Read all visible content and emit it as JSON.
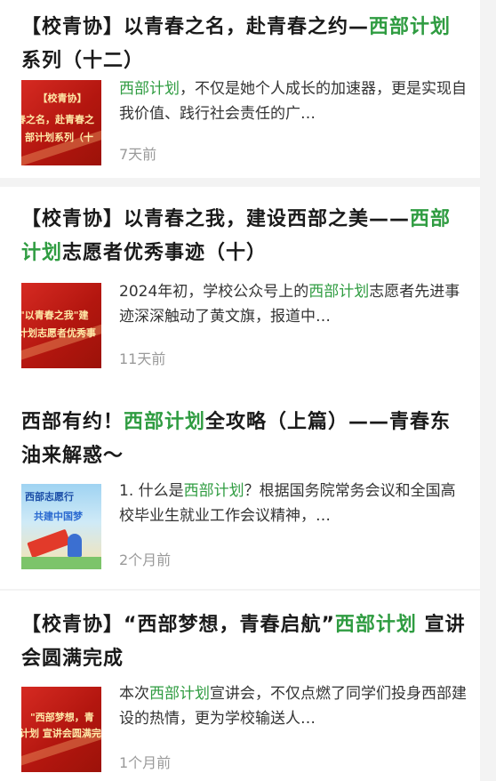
{
  "articles": [
    {
      "title_parts": {
        "before": "【校青协】以青春之名，赴青春之约—",
        "highlight": "西部计划",
        "after": "系列（十二）"
      },
      "summary_parts": {
        "before": "",
        "highlight": "西部计划",
        "after": "，不仅是她个人成长的加速器，更是实现自我价值、践行社会责任的广…"
      },
      "time": "7天前",
      "thumb_lines": [
        "【校青协】",
        "春之名，赴青春之",
        "部计划系列（十"
      ]
    },
    {
      "title_parts": {
        "before": "【校青协】以青春之我，建设西部之美——",
        "highlight": "西部计划",
        "after": "志愿者优秀事迹（十）"
      },
      "summary_parts": {
        "before": "2024年初，学校公众号上的",
        "highlight": "西部计划",
        "after": "志愿者先进事迹深深触动了黄文旗，报道中…"
      },
      "time": "11天前",
      "thumb_lines": [
        "\"以青春之我\"建",
        "计划志愿者优秀事"
      ]
    },
    {
      "title_parts": {
        "before": "西部有约！",
        "highlight": "西部计划",
        "after": "全攻略（上篇）——青春东油来解惑～"
      },
      "summary_parts": {
        "before": "1. 什么是",
        "highlight": "西部计划",
        "after": "？根据国务院常务会议和全国高校毕业生就业工作会议精神，…"
      },
      "time": "2个月前",
      "thumb_lines": [
        "西部志愿行",
        "共建中国梦"
      ]
    },
    {
      "title_parts": {
        "before": "【校青协】“西部梦想，青春启航”",
        "highlight": "西部计划",
        "after": " 宣讲会圆满完成"
      },
      "summary_parts": {
        "before": "本次",
        "highlight": "西部计划",
        "after": "宣讲会，不仅点燃了同学们投身西部建设的热情，更为学校输送人…"
      },
      "time": "1个月前",
      "thumb_lines": [
        "\"西部梦想，青",
        "计划 宣讲会圆满完"
      ]
    }
  ]
}
